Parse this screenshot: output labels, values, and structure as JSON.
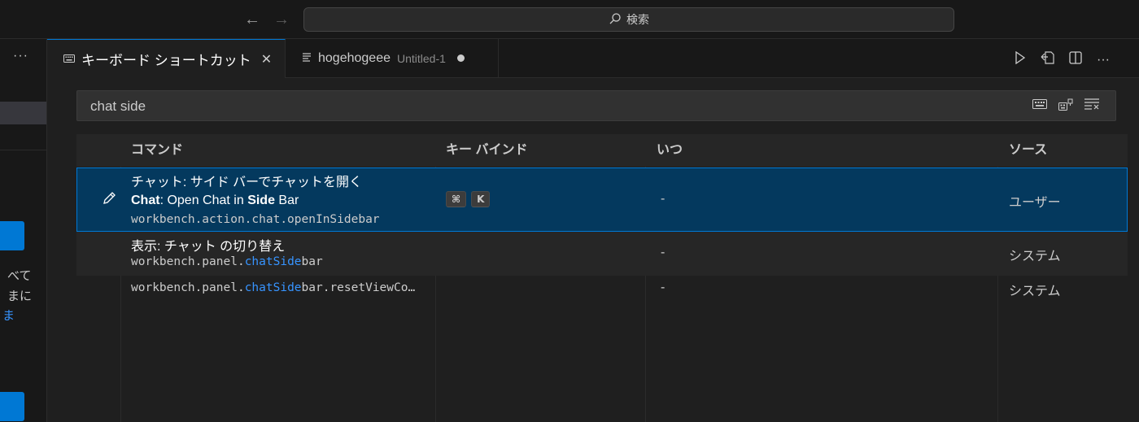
{
  "titlebar": {
    "back_icon": "arrow-left-icon",
    "forward_icon": "arrow-right-icon",
    "search_label": "検索"
  },
  "sidebar": {
    "more": "···",
    "texts": [
      "べて",
      "まに",
      "ま"
    ]
  },
  "tabs": [
    {
      "icon": "keyboard-icon",
      "label": "キーボード ショートカット",
      "close": "✕"
    },
    {
      "icon": "file-lines-icon",
      "label": "hogehogeee",
      "description": "Untitled-1"
    }
  ],
  "keybindings": {
    "search_value": "chat side",
    "columns": {
      "command": "コマンド",
      "keybinding": "キー バインド",
      "when": "いつ",
      "source": "ソース"
    },
    "rows": [
      {
        "title": "チャット: サイド バーでチャットを開く",
        "label_bold_1": "Chat",
        "label_mid": ": Open Chat in ",
        "label_bold_2": "Side",
        "label_end": " Bar",
        "id": "workbench.action.chat.openInSidebar",
        "keys": [
          "⌘",
          "K"
        ],
        "when": "-",
        "source": "ユーザー"
      },
      {
        "title": "表示: チャット の切り替え",
        "id_pre": "workbench.panel.",
        "id_hl": "chatSide",
        "id_post": "bar",
        "when": "-",
        "source": "システム"
      },
      {
        "id_pre": "workbench.panel.",
        "id_hl": "chatSide",
        "id_post": "bar.resetViewCo…",
        "when": "-",
        "source": "システム"
      }
    ]
  },
  "colors": {
    "accent": "#0078d4",
    "selection": "#04395e",
    "highlight": "#3794ff"
  }
}
